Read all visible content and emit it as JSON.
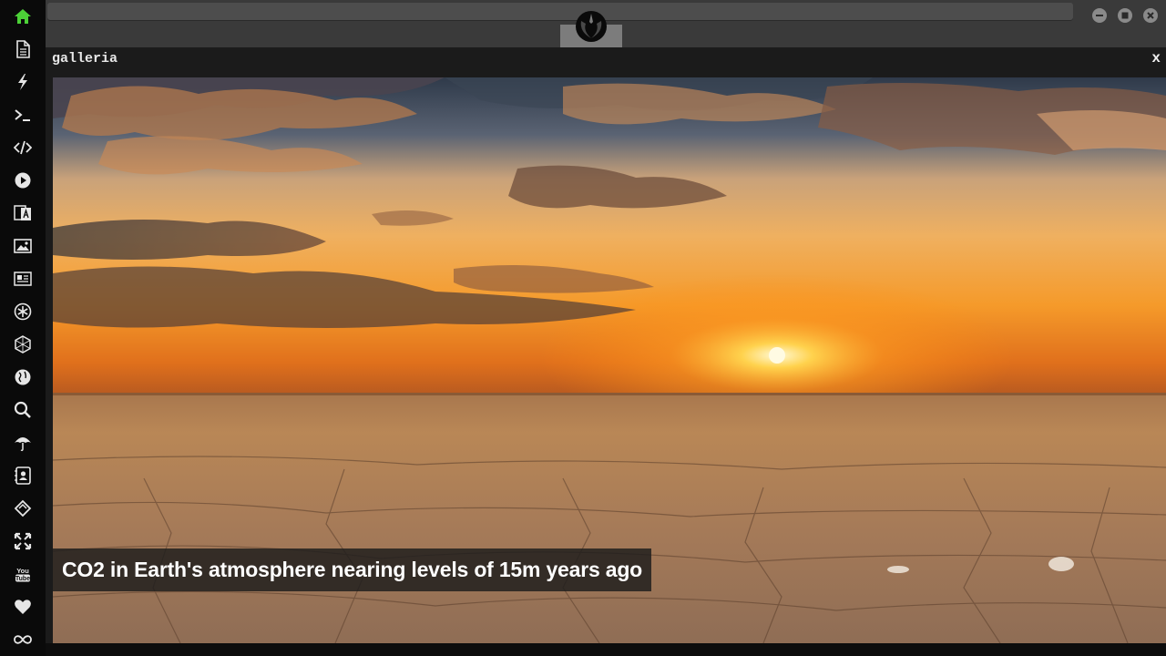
{
  "panel": {
    "title": "galleria",
    "close_label": "x"
  },
  "gallery": {
    "caption": "CO2 in Earth's atmosphere nearing levels of 15m years ago"
  },
  "sidebar": {
    "items": [
      {
        "icon": "home-icon",
        "active": true
      },
      {
        "icon": "document-icon"
      },
      {
        "icon": "lightning-icon"
      },
      {
        "icon": "terminal-icon"
      },
      {
        "icon": "code-icon"
      },
      {
        "icon": "play-icon"
      },
      {
        "icon": "translate-icon"
      },
      {
        "icon": "image-icon"
      },
      {
        "icon": "newspaper-icon"
      },
      {
        "icon": "asterisk-icon"
      },
      {
        "icon": "hexagon-icon"
      },
      {
        "icon": "globe-icon"
      },
      {
        "icon": "search-icon"
      },
      {
        "icon": "umbrella-icon"
      },
      {
        "icon": "contact-icon"
      },
      {
        "icon": "diamond-icon"
      },
      {
        "icon": "fullscreen-icon"
      },
      {
        "icon": "youtube-icon"
      },
      {
        "icon": "heart-icon"
      },
      {
        "icon": "infinity-icon"
      }
    ]
  },
  "window_controls": [
    "minimize-icon",
    "maximize-icon",
    "close-icon"
  ],
  "colors": {
    "active_icon": "#4cd137",
    "icon": "#e6e6e6",
    "accent_sky": "#f5a62a"
  }
}
